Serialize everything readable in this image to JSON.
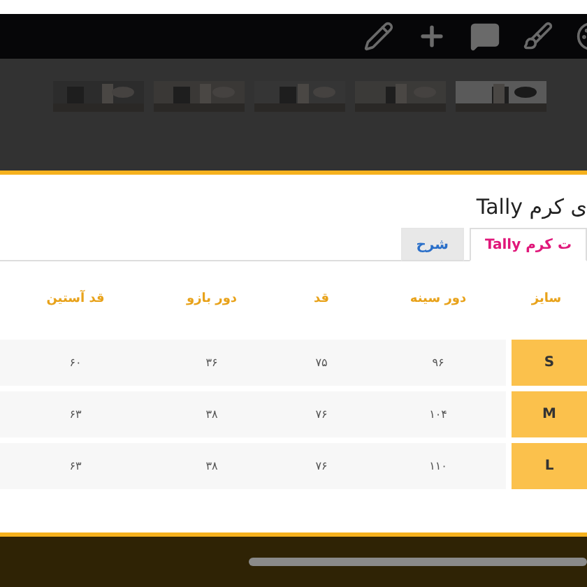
{
  "title": "ی کرم Tally",
  "tabs": [
    {
      "label": "ت کرم Tally",
      "selected": true
    },
    {
      "label": "شرح",
      "selected": false
    }
  ],
  "table": {
    "columns": [
      "سایز",
      "دور سینه",
      "قد",
      "دور بازو",
      "قد آستین"
    ],
    "rows": [
      {
        "cells": [
          "S",
          "۹۶",
          "۷۵",
          "۳۶",
          "۶۰"
        ]
      },
      {
        "cells": [
          "M",
          "۱۰۴",
          "۷۶",
          "۳۸",
          "۶۳"
        ]
      },
      {
        "cells": [
          "L",
          "۱۱۰",
          "۷۶",
          "۳۸",
          "۶۳"
        ]
      }
    ]
  }
}
